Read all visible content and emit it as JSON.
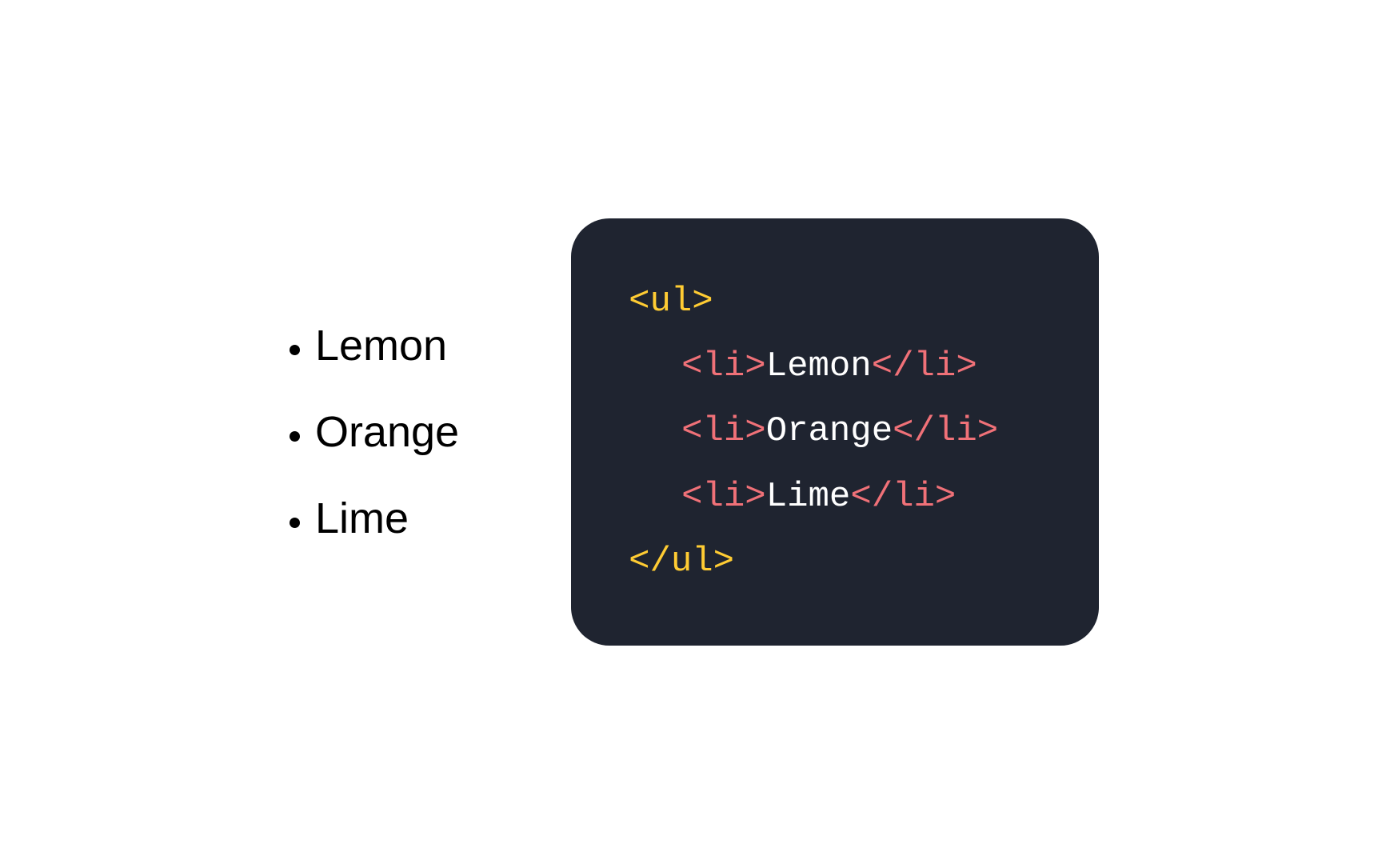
{
  "list": {
    "items": [
      "Lemon",
      "Orange",
      "Lime"
    ]
  },
  "code": {
    "ul_open": "<ul>",
    "ul_close": "</ul>",
    "li_open": "<li>",
    "li_close": "</li>",
    "lines": [
      {
        "text": "Lemon"
      },
      {
        "text": "Orange"
      },
      {
        "text": "Lime"
      }
    ]
  },
  "colors": {
    "code_bg": "#1f2430",
    "tag_outer": "#ffcc33",
    "tag_inner": "#f07178",
    "text": "#ffffff"
  }
}
